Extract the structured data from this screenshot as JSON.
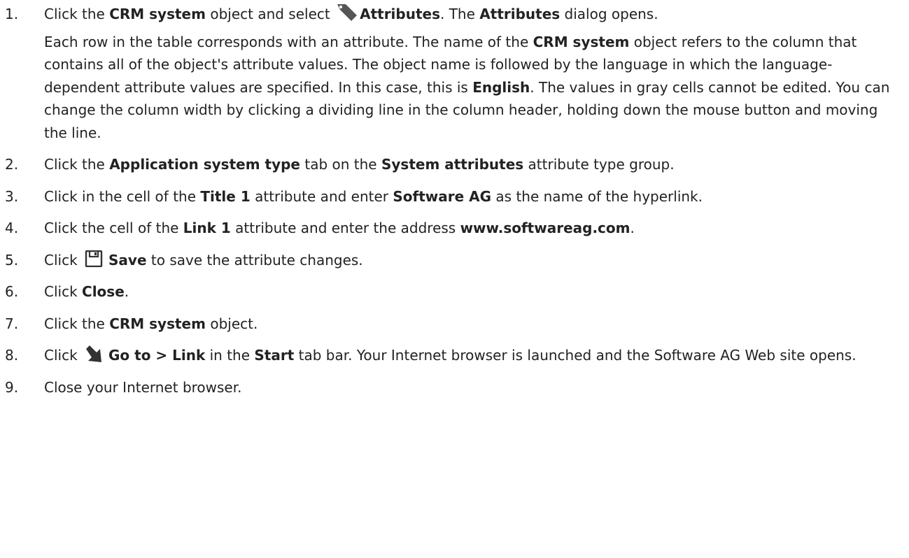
{
  "steps": [
    {
      "number": "1.",
      "line1": {
        "t1": "Click the ",
        "b1": "CRM system",
        "t2": " object and select ",
        "icon": "tag-icon",
        "b2": "Attributes",
        "t3": ". The ",
        "b3": "Attributes",
        "t4": " dialog opens."
      },
      "para": {
        "t1": "Each row in the table corresponds with an attribute. The name of the ",
        "b1": "CRM system",
        "t2": " object refers to the column that contains all of the object's attribute values. The object name is followed by the language in which the language-dependent attribute values are specified. In this case, this is ",
        "b2": "English",
        "t3": ". The values in gray cells cannot be edited. You can change the column width by clicking a dividing line in the column header, holding down the mouse button and moving the line."
      }
    },
    {
      "number": "2.",
      "t1": "Click the ",
      "b1": "Application system type",
      "t2": " tab on the ",
      "b2": "System attributes",
      "t3": " attribute type group."
    },
    {
      "number": "3.",
      "t1": "Click in the cell of the ",
      "b1": "Title 1",
      "t2": " attribute and enter ",
      "b2": "Software AG",
      "t3": " as the name of the hyperlink."
    },
    {
      "number": "4.",
      "t1": "Click the cell of the ",
      "b1": "Link 1",
      "t2": " attribute and enter the address ",
      "b2": "www.softwareag.com",
      "t3": "."
    },
    {
      "number": "5.",
      "t1": "Click ",
      "icon": "save-icon",
      "b1": "Save",
      "t2": " to save the attribute changes."
    },
    {
      "number": "6.",
      "t1": "Click ",
      "b1": "Close",
      "t2": "."
    },
    {
      "number": "7.",
      "t1": "Click the ",
      "b1": "CRM system",
      "t2": " object."
    },
    {
      "number": "8.",
      "t1": "Click ",
      "icon": "go-to-arrow-icon",
      "b1": "Go to > Link",
      "t2": " in the ",
      "b2": "Start",
      "t3": " tab bar. Your Internet browser is launched and the Software AG Web site opens."
    },
    {
      "number": "9.",
      "t1": "Close your Internet browser."
    }
  ],
  "colors": {
    "text": "#222222",
    "icon": "#555555",
    "background": "#ffffff"
  }
}
